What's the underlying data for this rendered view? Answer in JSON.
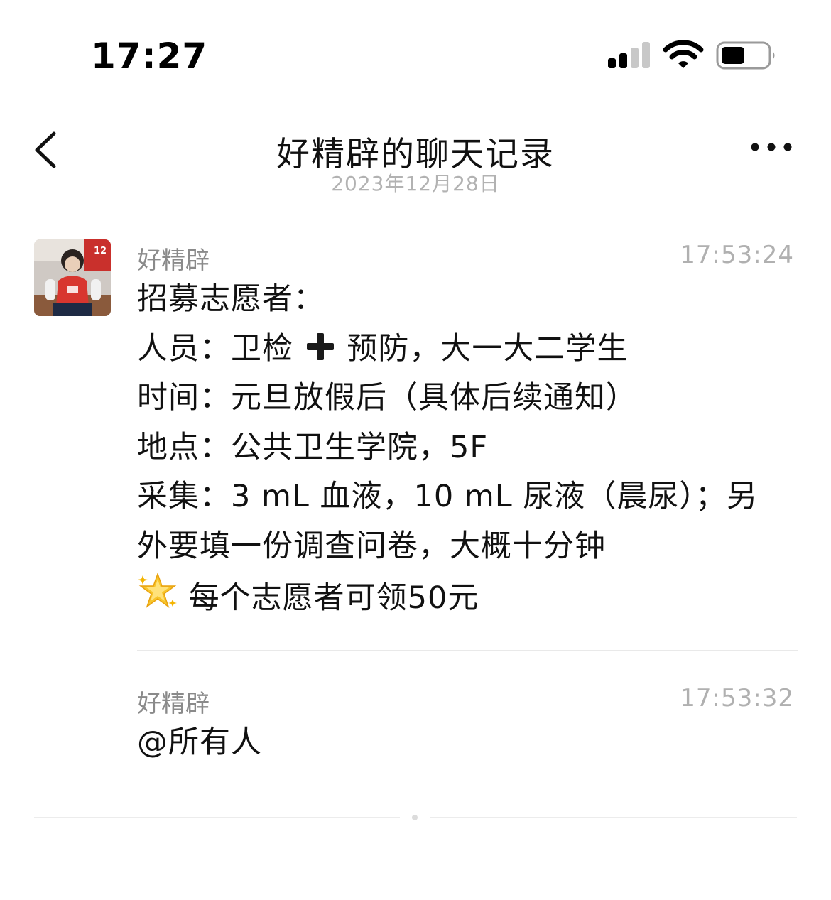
{
  "status_bar": {
    "time": "17:27",
    "icons": [
      "cellular-signal-icon",
      "wifi-icon",
      "battery-icon"
    ]
  },
  "nav": {
    "back_icon": "chevron-left-icon",
    "title": "好精辟的聊天记录",
    "date": "2023年12月28日",
    "more_icon": "more-dots-icon"
  },
  "messages": [
    {
      "sender": "好精辟",
      "time": "17:53:24",
      "has_avatar": true,
      "lines": {
        "l1": "招募志愿者：",
        "l2a": "人员：卫检",
        "l2_icon": "plus-emoji-icon",
        "l2b": "预防，大一大二学生",
        "l3": "时间：元旦放假后（具体后续通知）",
        "l4": "地点：公共卫生学院，5F",
        "l5": "采集：3 mL 血液，10 mL 尿液（晨尿）；另",
        "l6": "外要填一份调查问卷，大概十分钟",
        "l7_icon": "glowing-star-emoji-icon",
        "l7": "每个志愿者可领50元"
      }
    },
    {
      "sender": "好精辟",
      "time": "17:53:32",
      "has_avatar": false,
      "lines": {
        "l1": "@所有人"
      }
    }
  ],
  "colors": {
    "text": "#111111",
    "secondary": "#8a8a8a",
    "timestamp": "#b0b0b0",
    "divider": "#e9e9e9"
  }
}
